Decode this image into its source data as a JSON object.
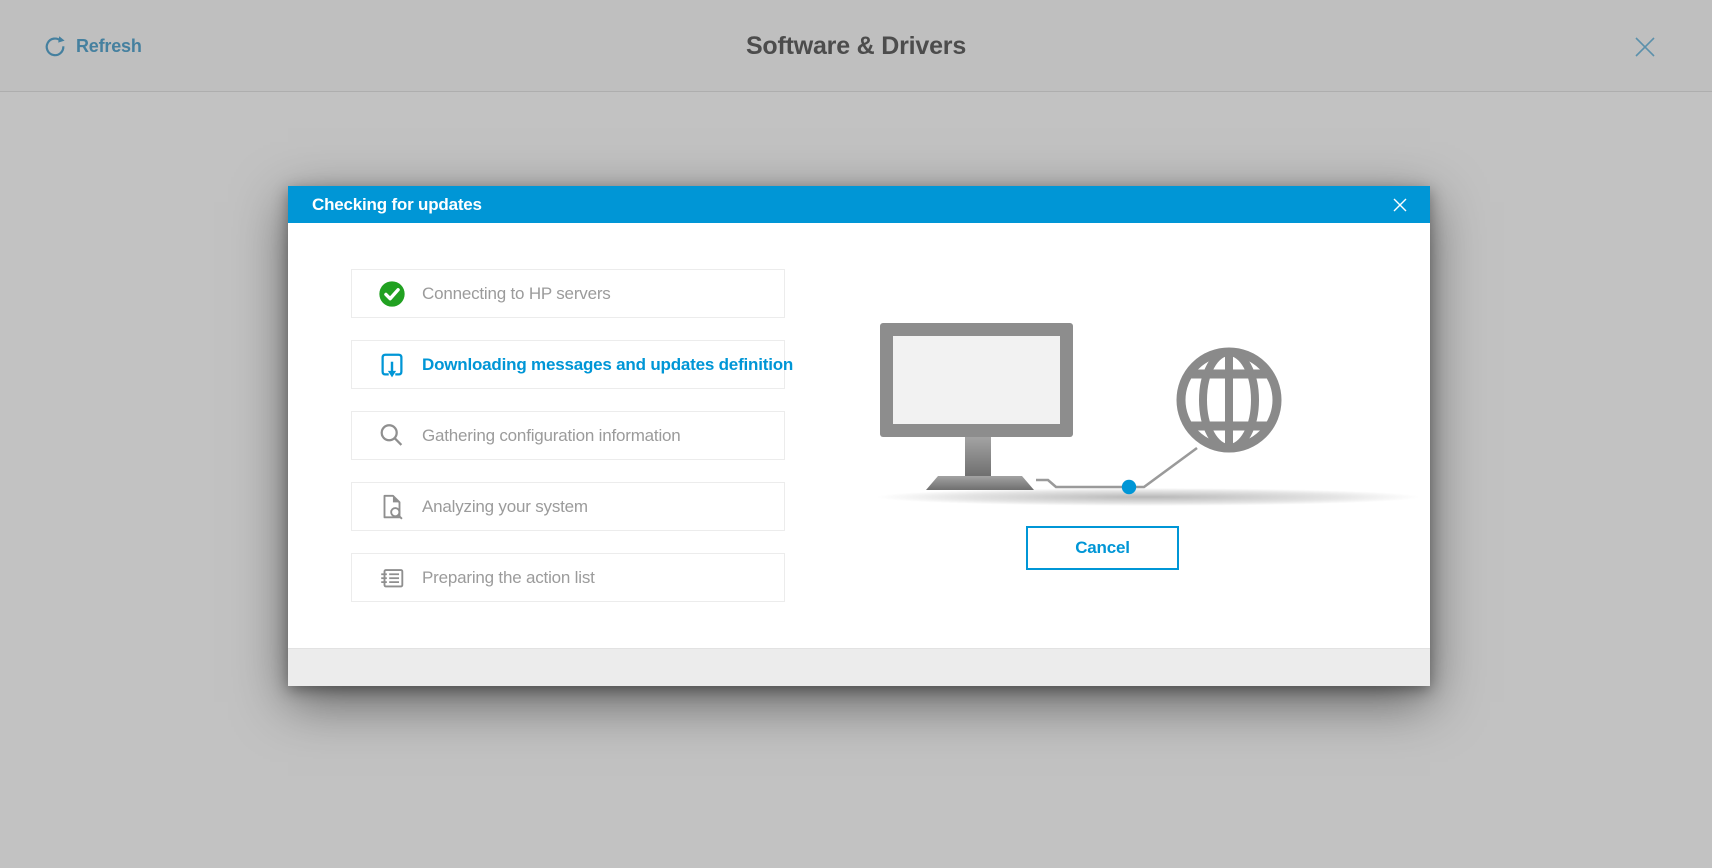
{
  "app": {
    "title": "Software & Drivers",
    "refresh_label": "Refresh"
  },
  "dialog": {
    "title": "Checking for updates",
    "steps": [
      {
        "label": "Connecting to HP servers",
        "state": "done",
        "icon": "check-circle-icon"
      },
      {
        "label": "Downloading messages and updates definition",
        "state": "active",
        "icon": "download-icon"
      },
      {
        "label": "Gathering configuration information",
        "state": "pending",
        "icon": "magnifier-icon"
      },
      {
        "label": "Analyzing your system",
        "state": "pending",
        "icon": "document-magnifier-icon"
      },
      {
        "label": "Preparing the action list",
        "state": "pending",
        "icon": "action-list-icon"
      }
    ],
    "cancel_label": "Cancel",
    "illustration": "computer-connecting-to-internet"
  },
  "colors": {
    "accent_blue": "#0096d6",
    "success_green": "#21a121",
    "pending_text_gray": "#9b9b9b",
    "dimmed_link_blue": "#45809f",
    "overlay_gray": "#c2c2c2"
  }
}
